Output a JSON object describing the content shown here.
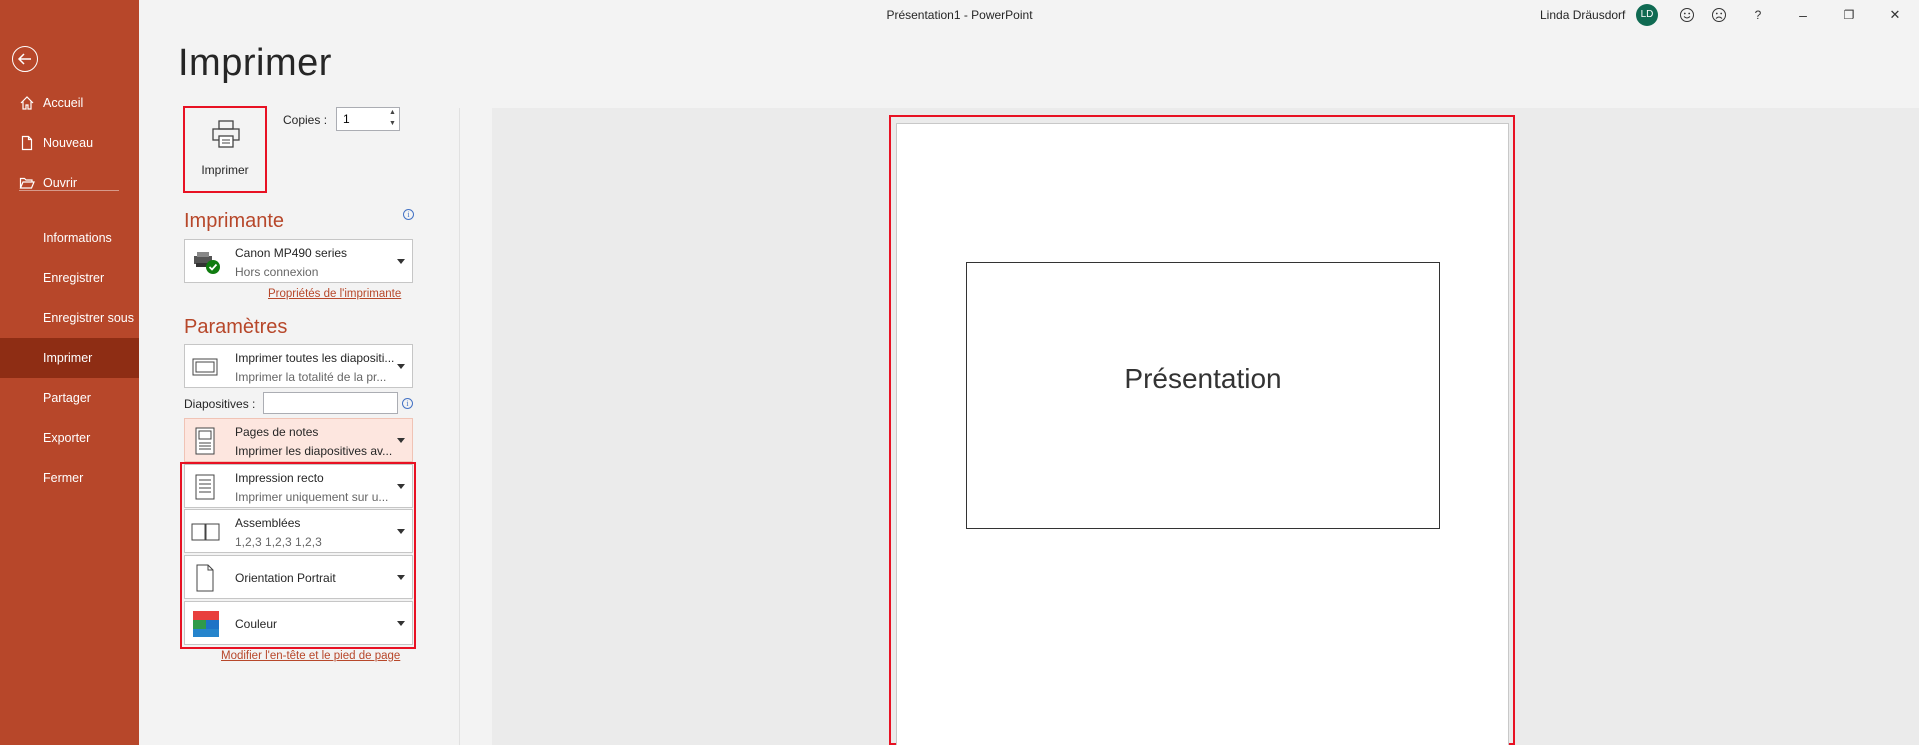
{
  "window": {
    "title": "Présentation1  -  PowerPoint",
    "user_name": "Linda Dräusdorf",
    "user_initials": "LD",
    "help_label": "?",
    "minimize": "–",
    "restore": "❐",
    "close": "✕"
  },
  "sidebar": {
    "accent_color": "#b7472a",
    "selected_color": "#8e2d14",
    "items": [
      {
        "label": "Accueil",
        "icon": "home-icon"
      },
      {
        "label": "Nouveau",
        "icon": "new-document-icon"
      },
      {
        "label": "Ouvrir",
        "icon": "folder-open-icon"
      },
      {
        "label": "Informations"
      },
      {
        "label": "Enregistrer"
      },
      {
        "label": "Enregistrer sous"
      },
      {
        "label": "Imprimer",
        "selected": true
      },
      {
        "label": "Partager"
      },
      {
        "label": "Exporter"
      },
      {
        "label": "Fermer"
      }
    ]
  },
  "print": {
    "page_title": "Imprimer",
    "print_button_label": "Imprimer",
    "copies_label": "Copies :",
    "copies_value": "1",
    "printer_heading": "Imprimante",
    "printer": {
      "name": "Canon MP490 series",
      "status": "Hors connexion"
    },
    "printer_properties_link": "Propriétés de l'imprimante",
    "settings_heading": "Paramètres",
    "slides_range": {
      "title": "Imprimer toutes les diapositi...",
      "subtitle": "Imprimer la totalité de la pr..."
    },
    "slides_label": "Diapositives :",
    "slides_value": "",
    "layout": {
      "title": "Pages de notes",
      "subtitle": "Imprimer les diapositives av..."
    },
    "sides": {
      "title": "Impression recto",
      "subtitle": "Imprimer uniquement sur u..."
    },
    "collation": {
      "title": "Assemblées",
      "subtitle": "1,2,3    1,2,3    1,2,3"
    },
    "orientation": "Orientation Portrait",
    "color": "Couleur",
    "header_footer_link": "Modifier l'en-tête et le pied de page"
  },
  "preview": {
    "slide_title": "Présentation"
  }
}
